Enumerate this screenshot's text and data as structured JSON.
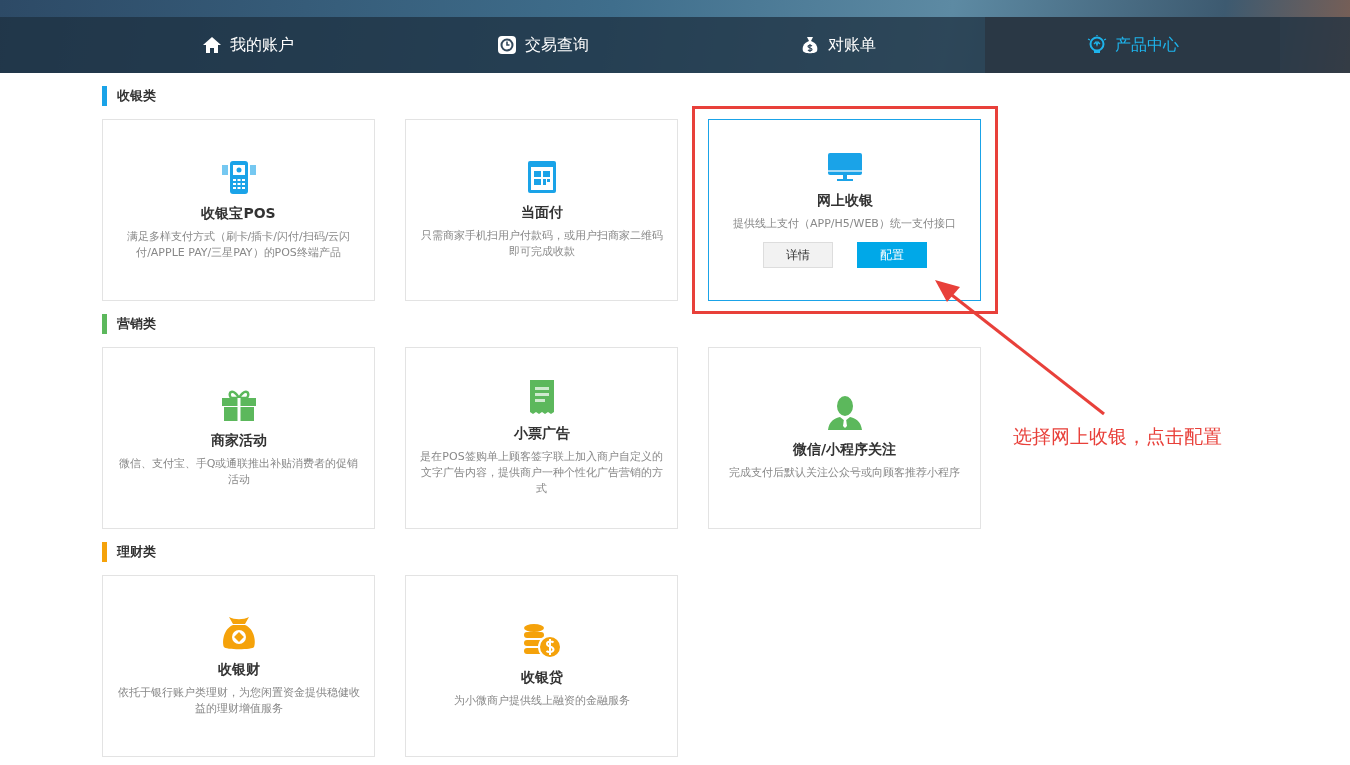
{
  "nav": [
    {
      "label": "我的账户",
      "selected": false
    },
    {
      "label": "交易查询",
      "selected": false
    },
    {
      "label": "对账单",
      "selected": false
    },
    {
      "label": "产品中心",
      "selected": true
    }
  ],
  "sections": [
    {
      "title": "收银类",
      "color": "#1aa3e8",
      "cards": [
        {
          "kind": "plain",
          "highlighted": false,
          "title": "收银宝POS",
          "desc": "满足多样支付方式（刷卡/插卡/闪付/扫码/云闪付/APPLE PAY/三星PAY）的POS终端产品"
        },
        {
          "kind": "plain",
          "highlighted": false,
          "title": "当面付",
          "desc": "只需商家手机扫用户付款码，或用户扫商家二维码即可完成收款"
        },
        {
          "kind": "actions",
          "highlighted": true,
          "title": "网上收银",
          "desc": "提供线上支付（APP/H5/WEB）统一支付接口",
          "buttons": [
            {
              "label": "详情",
              "primary": false
            },
            {
              "label": "配置",
              "primary": true
            }
          ]
        }
      ]
    },
    {
      "title": "营销类",
      "color": "#5cb85c",
      "cards": [
        {
          "kind": "plain",
          "highlighted": false,
          "title": "商家活动",
          "desc": "微信、支付宝、手Q或通联推出补贴消费者的促销活动"
        },
        {
          "kind": "plain",
          "highlighted": false,
          "title": "小票广告",
          "desc": "是在POS签购单上顾客签字联上加入商户自定义的文字广告内容，提供商户一种个性化广告营销的方式"
        },
        {
          "kind": "plain",
          "highlighted": false,
          "title": "微信/小程序关注",
          "desc": "完成支付后默认关注公众号或向顾客推荐小程序"
        }
      ]
    },
    {
      "title": "理财类",
      "color": "#f5a20a",
      "cards": [
        {
          "kind": "plain",
          "highlighted": false,
          "title": "收银财",
          "desc": "依托于银行账户类理财，为您闲置资金提供稳健收益的理财增值服务"
        },
        {
          "kind": "plain",
          "highlighted": false,
          "title": "收银贷",
          "desc": "为小微商户提供线上融资的金融服务"
        }
      ]
    }
  ],
  "annotation": {
    "text": "选择网上收银，点击配置"
  }
}
